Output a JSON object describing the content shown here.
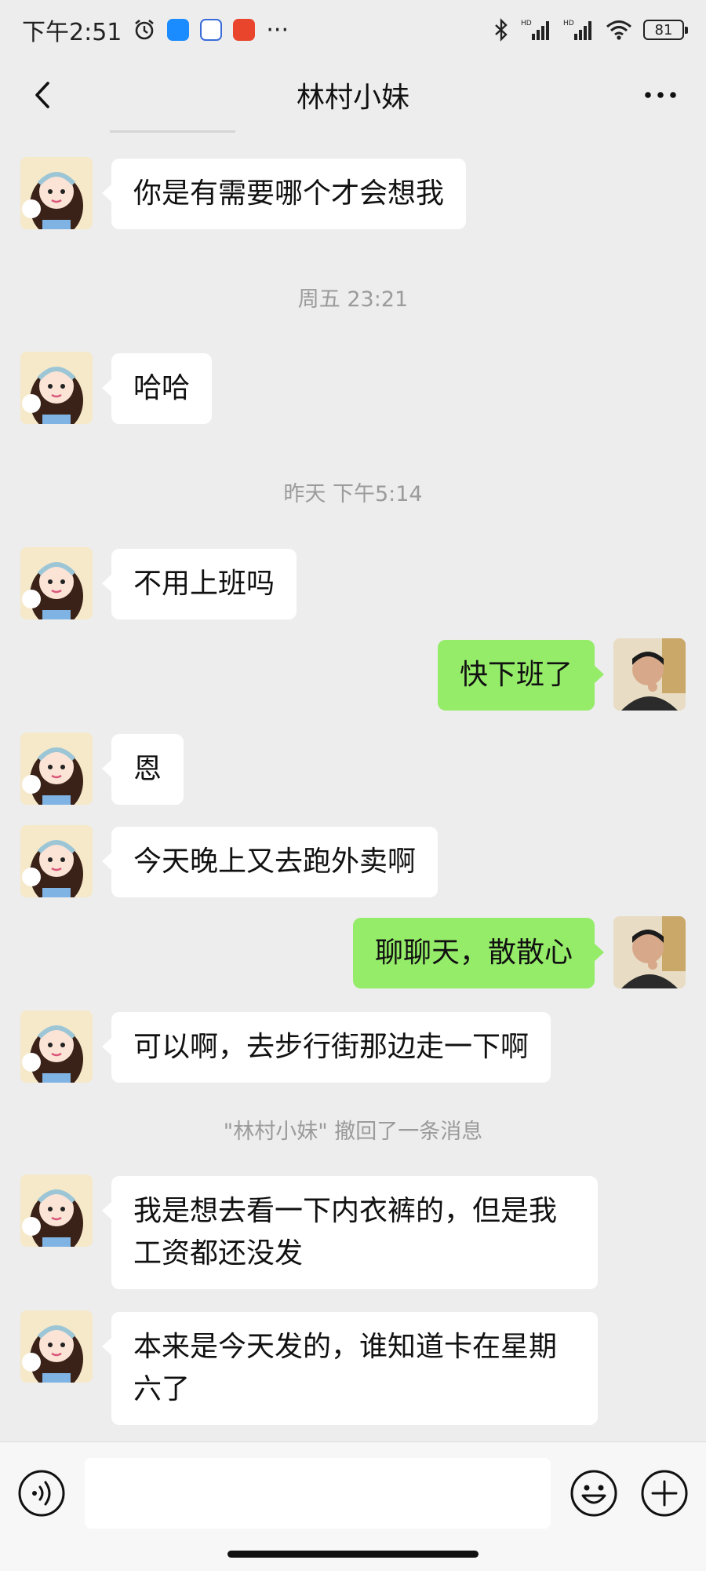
{
  "status_bar": {
    "time": "下午2:51",
    "overflow": "···",
    "battery": "81",
    "icons": [
      "alarm-icon",
      "bluebird-app-icon",
      "baidu-app-icon",
      "red-app-icon",
      "bluetooth-icon",
      "hd-signal-icon",
      "hd-signal-icon",
      "wifi-icon",
      "battery-icon"
    ]
  },
  "header": {
    "title": "林村小妹",
    "back_icon": "chevron-left-icon",
    "more_icon": "more-dots-icon"
  },
  "messages": [
    {
      "type": "text",
      "side": "left",
      "text": "你是有需要哪个才会想我"
    },
    {
      "type": "time",
      "text": "周五 23:21"
    },
    {
      "type": "text",
      "side": "left",
      "text": "哈哈"
    },
    {
      "type": "time",
      "text": "昨天 下午5:14"
    },
    {
      "type": "text",
      "side": "left",
      "text": "不用上班吗"
    },
    {
      "type": "text",
      "side": "right",
      "text": "快下班了"
    },
    {
      "type": "text",
      "side": "left",
      "text": "恩"
    },
    {
      "type": "text",
      "side": "left",
      "text": "今天晚上又去跑外卖啊"
    },
    {
      "type": "text",
      "side": "right",
      "text": "聊聊天，散散心"
    },
    {
      "type": "text",
      "side": "left",
      "text": "可以啊，去步行街那边走一下啊"
    },
    {
      "type": "system",
      "text": "\"林村小妹\" 撤回了一条消息"
    },
    {
      "type": "text",
      "side": "left",
      "lines": [
        "我是想去看一下内衣裤的，但是我",
        "工资都还没发"
      ]
    },
    {
      "type": "text",
      "side": "left",
      "lines": [
        "本来是今天发的，谁知道卡在星期",
        "六了"
      ]
    }
  ],
  "input_bar": {
    "text_value": "",
    "icons": [
      "voice-icon",
      "emoji-icon",
      "plus-icon"
    ]
  },
  "colors": {
    "background": "#ededed",
    "received_bubble": "#ffffff",
    "sent_bubble": "#95ec69",
    "timestamp_text": "#9b9b9b"
  }
}
